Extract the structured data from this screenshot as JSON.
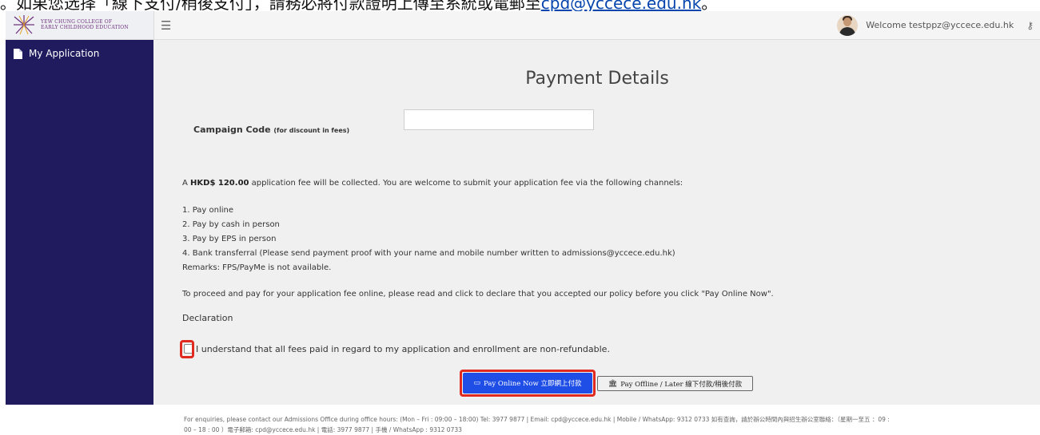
{
  "doc_strip": {
    "text": "。如果您选择「線下支付/稍後支付」，請務必將付款證明上傳至系統或電郵至",
    "link_text": "cpd@yccece.edu.hk",
    "tail": "。"
  },
  "brand": {
    "line1": "YEW CHUNG COLLEGE OF",
    "line2": "EARLY CHILDHOOD EDUCATION"
  },
  "topbar": {
    "menu_icon": "☰",
    "welcome": "Welcome testppz@yccece.edu.hk",
    "key_icon": "⚷"
  },
  "sidebar": {
    "items": [
      {
        "label": "My Application",
        "icon": "file-icon"
      }
    ]
  },
  "main": {
    "title": "Payment Details",
    "campaign_label": "Campaign Code",
    "campaign_hint": "(for discount in fees)",
    "campaign_value": "",
    "fee_prefix": "A ",
    "fee_amount": "HKD$ 120.00",
    "fee_suffix": " application fee will be collected. You are welcome to submit your application fee via the following channels:",
    "channels": [
      "1. Pay online",
      "2. Pay by cash in person",
      "3. Pay by EPS in person",
      "4. Bank transferral (Please send payment proof with your name and mobile number written to admissions@yccece.edu.hk)"
    ],
    "remarks": "Remarks: FPS/PayMe is not available.",
    "proceed_text": "To proceed and pay for your application fee online, please read and click to declare that you accepted our policy before you click \"Pay Online Now\".",
    "declaration_heading": "Declaration",
    "declaration_text": "I understand that all fees paid in regard to my application and enrollment are non-refundable.",
    "pay_online_label": "Pay Online Now 立即網上付款",
    "pay_offline_label": "Pay Offline / Later 線下付款/稍後付款",
    "footer_line1": "For enquiries, please contact our Admissions Office during office hours: (Mon – Fri : 09:00 – 18:00) Tel: 3977 9877 | Email: cpd@yccece.edu.hk | Mobile / WhatsApp: 9312 0733 如有查詢，請於辦公時間內與招生辦公室聯絡：（星期一至五 ：09 :",
    "footer_line2": "00 – 18 : 00 ）電子郵箱: cpd@yccece.edu.hk | 電話: 3977 9877 | 手機 / WhatsApp : 9312 0733"
  },
  "colors": {
    "sidebar_bg": "#1f1b5e",
    "primary_button": "#1f4ee6",
    "highlight": "#e0291f"
  }
}
